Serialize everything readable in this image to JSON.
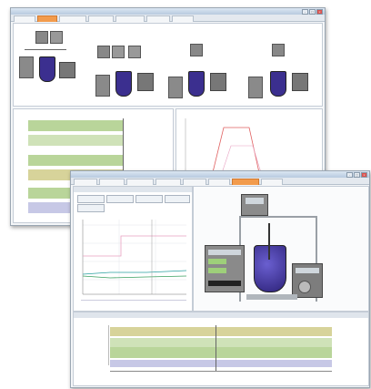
{
  "back_window": {
    "title": "",
    "tabs": [
      "",
      "",
      "",
      "",
      "",
      "",
      ""
    ],
    "active_tab": 1
  },
  "front_window": {
    "title": "",
    "tabs": [
      "",
      "",
      "",
      "",
      "",
      "",
      "",
      ""
    ],
    "active_tab": 6
  },
  "colors": {
    "accent_orange": "#f29b4c",
    "vessel_purple": "#3b2f8f",
    "band_green": "#b9d59a",
    "band_olive": "#d7d39a",
    "band_lavender": "#c7c8e6",
    "line_red": "#e06060",
    "line_pink": "#e8a0c0",
    "line_teal": "#2aa0a0"
  },
  "icons": [
    "minimize-icon",
    "maximize-icon",
    "close-icon",
    "gear-icon",
    "vessel-icon",
    "chart-icon"
  ]
}
